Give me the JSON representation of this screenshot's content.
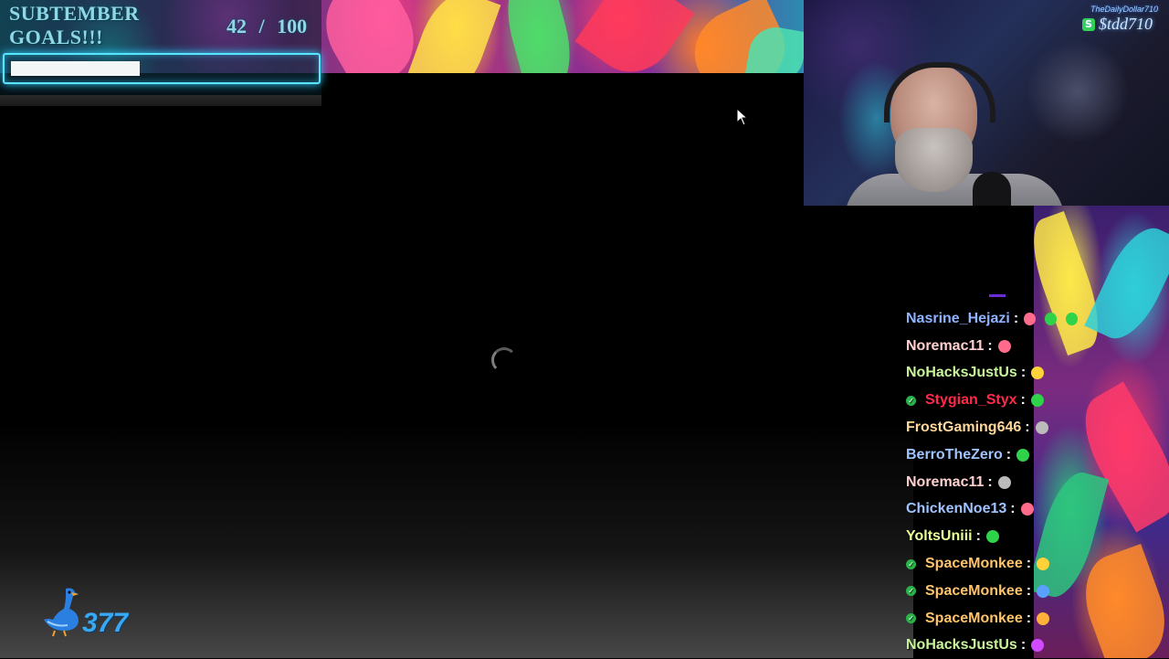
{
  "goal": {
    "title_line1": "SUBTEMBER",
    "title_line2": "GOALS!!!",
    "current": "42",
    "separator": "/",
    "target": "100",
    "progress_percent": 42
  },
  "webcam": {
    "donation_name": "TheDailyDollar710",
    "cashtag": "$tdd710",
    "cash_icon": "S"
  },
  "goose": {
    "icon": "goose-icon",
    "count": "377"
  },
  "chat": {
    "messages": [
      {
        "user": "Nasrine_Hejazi",
        "color": "#8fb3ff",
        "badge": false,
        "sep": ":",
        "emotes": [
          "#ff6b8b",
          "#2fd34a",
          "#2fd34a"
        ]
      },
      {
        "user": "Noremac11",
        "color": "#ffd0d0",
        "badge": false,
        "sep": ":",
        "emotes": [
          "#ff6b8b"
        ]
      },
      {
        "user": "NoHacksJustUs",
        "color": "#c8f59a",
        "badge": false,
        "sep": ":",
        "emotes": [
          "#ffd23a"
        ]
      },
      {
        "user": "Stygian_Styx",
        "color": "#ff2a4a",
        "badge": true,
        "sep": ":",
        "emotes": [
          "#2fd34a"
        ]
      },
      {
        "user": "FrostGaming646",
        "color": "#ffd89a",
        "badge": false,
        "sep": ":",
        "emotes": [
          "#bbbbbb"
        ]
      },
      {
        "user": "BerroTheZero",
        "color": "#9fc4ff",
        "badge": false,
        "sep": ":",
        "emotes": [
          "#2fd34a"
        ]
      },
      {
        "user": "Noremac11",
        "color": "#ffd0d0",
        "badge": false,
        "sep": ":",
        "emotes": [
          "#bbbbbb"
        ]
      },
      {
        "user": "ChickenNoe13",
        "color": "#9fc4ff",
        "badge": false,
        "sep": ":",
        "emotes": [
          "#ff6b8b"
        ]
      },
      {
        "user": "YoltsUniii",
        "color": "#eaff9a",
        "badge": false,
        "sep": ":",
        "emotes": [
          "#2fd34a"
        ]
      },
      {
        "user": "SpaceMonkee",
        "color": "#ffc46b",
        "badge": true,
        "sep": ":",
        "emotes": [
          "#ffd23a"
        ]
      },
      {
        "user": "SpaceMonkee",
        "color": "#ffc46b",
        "badge": true,
        "sep": ":",
        "emotes": [
          "#5aa0ff"
        ]
      },
      {
        "user": "SpaceMonkee",
        "color": "#ffc46b",
        "badge": true,
        "sep": ":",
        "emotes": [
          "#ffb03a"
        ]
      },
      {
        "user": "NoHacksJustUs",
        "color": "#c8f59a",
        "badge": false,
        "sep": ":",
        "emotes": [
          "#d04aff"
        ]
      }
    ]
  },
  "colors": {
    "goal_text": "#8fd7e6",
    "progress_border": "#58e6ff",
    "goose_blue": "#3aa8f0"
  }
}
